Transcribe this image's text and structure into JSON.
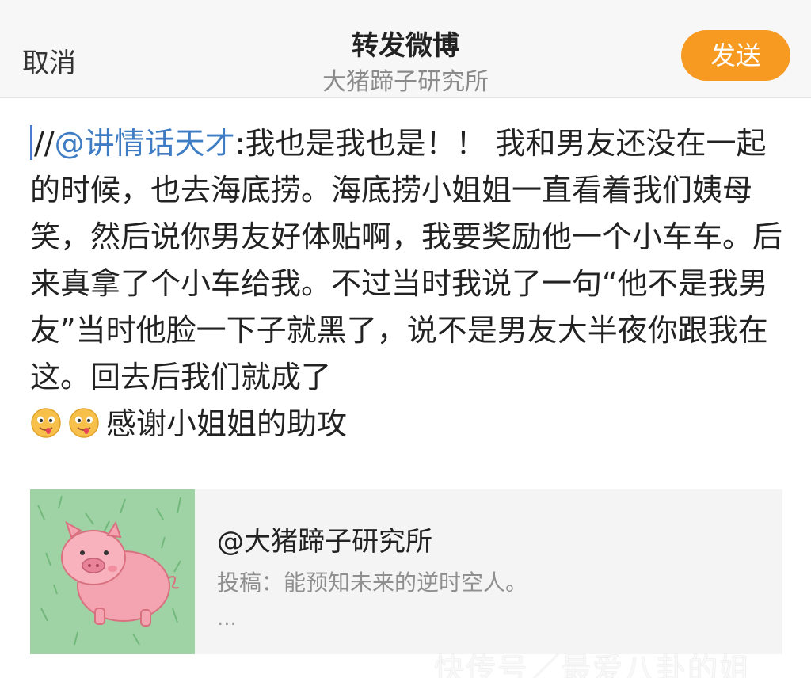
{
  "header": {
    "cancel_label": "取消",
    "title": "转发微博",
    "subtitle": "大猪蹄子研究所",
    "send_label": "发送"
  },
  "editor": {
    "prefix": "//",
    "mention": "@讲情话天才",
    "colon": ":",
    "text": "我也是我也是！！ 我和男友还没在一起的时候，也去海底捞。海底捞小姐姐一直看着我们姨母笑，然后说你男友好体贴啊，我要奖励他一个小车车。后来真拿了个小车给我。不过当时我说了一句“他不是我男友”当时他脸一下子就黑了，说不是男友大半夜你跟我在这。回去后我们就成了",
    "suffix": "感谢小姐姐的助攻",
    "emoji_icon": "drooling-face-icon"
  },
  "card": {
    "name": "@大猪蹄子研究所",
    "desc": "投稿：能预知未来的逆时空人。",
    "more": "...",
    "thumb_icon": "pink-pig-avatar-icon"
  },
  "watermark": "快传号／最爱八卦的姐",
  "colors": {
    "accent": "#f79a22",
    "mention": "#3e7cc4",
    "header_bg": "#f7f7f7"
  }
}
